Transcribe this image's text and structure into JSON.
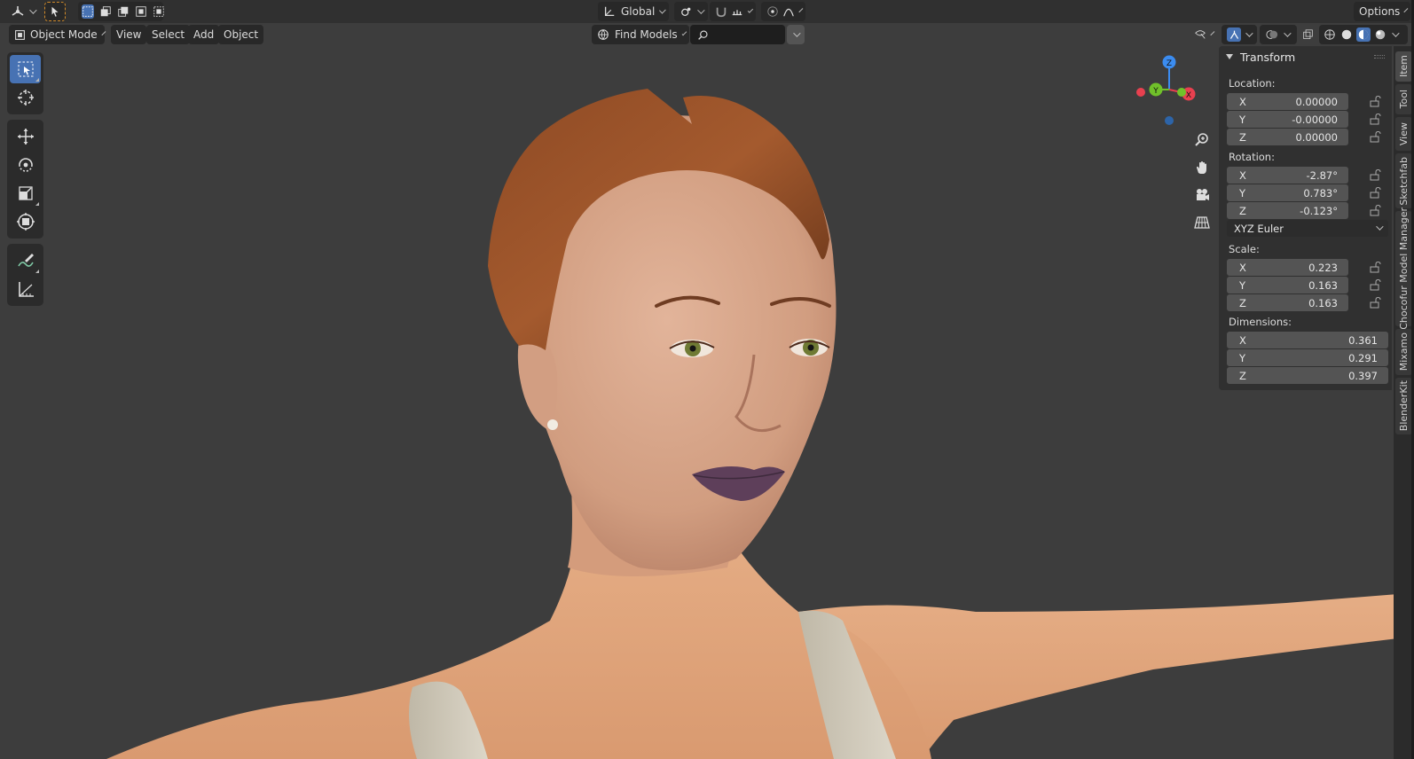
{
  "header": {
    "orientation_label": "Global",
    "options_label": "Options"
  },
  "subheader": {
    "mode_label": "Object Mode",
    "menus": [
      "View",
      "Select",
      "Add",
      "Object"
    ],
    "find_models_label": "Find Models",
    "search_placeholder": ""
  },
  "gizmo": {
    "z": "Z",
    "y": "Y",
    "x": "X"
  },
  "transform": {
    "title": "Transform",
    "location_label": "Location:",
    "location": [
      {
        "axis": "X",
        "value": "0.00000"
      },
      {
        "axis": "Y",
        "value": "-0.00000"
      },
      {
        "axis": "Z",
        "value": "0.00000"
      }
    ],
    "rotation_label": "Rotation:",
    "rotation": [
      {
        "axis": "X",
        "value": "-2.87°"
      },
      {
        "axis": "Y",
        "value": "0.783°"
      },
      {
        "axis": "Z",
        "value": "-0.123°"
      }
    ],
    "rotation_mode": "XYZ Euler",
    "scale_label": "Scale:",
    "scale": [
      {
        "axis": "X",
        "value": "0.223"
      },
      {
        "axis": "Y",
        "value": "0.163"
      },
      {
        "axis": "Z",
        "value": "0.163"
      }
    ],
    "dimensions_label": "Dimensions:",
    "dimensions": [
      {
        "axis": "X",
        "value": "0.361"
      },
      {
        "axis": "Y",
        "value": "0.291"
      },
      {
        "axis": "Z",
        "value": "0.397"
      }
    ]
  },
  "side_tabs": [
    "Item",
    "Tool",
    "View",
    "Sketchfab",
    "Chocofur Model Manager",
    "Mixamo",
    "BlenderKit"
  ],
  "colors": {
    "accent": "#4772b3",
    "gizmo_x": "#e8404f",
    "gizmo_y": "#70c12a",
    "gizmo_z": "#3b8cf0"
  }
}
